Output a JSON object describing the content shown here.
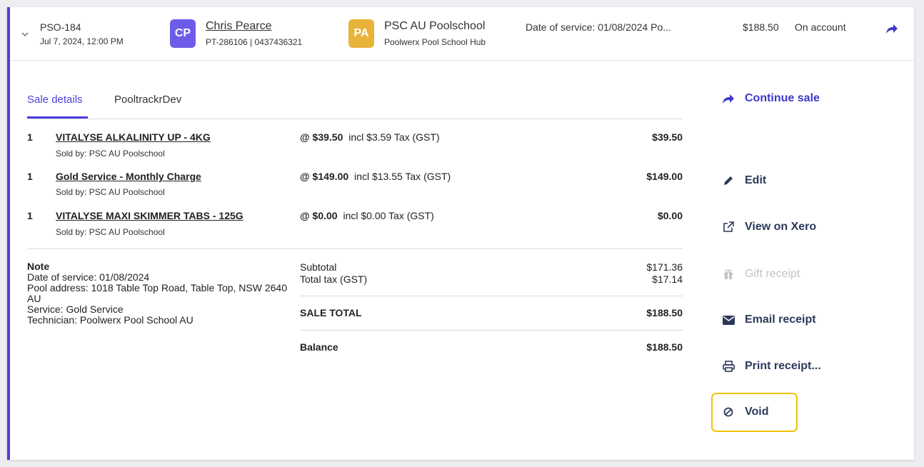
{
  "header": {
    "order_id": "PSO-184",
    "order_date": "Jul 7, 2024, 12:00 PM",
    "customer": {
      "initials": "CP",
      "name": "Chris Pearce",
      "details": "PT-286106 | 0437436321"
    },
    "store": {
      "initials": "PA",
      "name": "PSC AU Poolschool",
      "hub": "Poolwerx Pool School Hub"
    },
    "service_summary": "Date of service: 01/08/2024 Po...",
    "total": "$188.50",
    "payment_status": "On account"
  },
  "tabs": {
    "sale_details": "Sale details",
    "pooltrackr": "PooltrackrDev"
  },
  "items": [
    {
      "qty": "1",
      "name": "VITALYSE ALKALINITY UP - 4KG",
      "sold_by": "Sold by: PSC AU Poolschool",
      "unit_price": "@ $39.50",
      "tax": "incl $3.59 Tax (GST)",
      "amount": "$39.50"
    },
    {
      "qty": "1",
      "name": "Gold Service - Monthly Charge",
      "sold_by": "Sold by: PSC AU Poolschool",
      "unit_price": "@ $149.00",
      "tax": "incl $13.55 Tax (GST)",
      "amount": "$149.00"
    },
    {
      "qty": "1",
      "name": "VITALYSE MAXI SKIMMER TABS - 125G",
      "sold_by": "Sold by: PSC AU Poolschool",
      "unit_price": "@ $0.00",
      "tax": "incl $0.00 Tax (GST)",
      "amount": "$0.00"
    }
  ],
  "note": {
    "title": "Note",
    "lines": [
      "Date of service: 01/08/2024",
      "Pool address: 1018 Table Top Road, Table Top, NSW 2640",
      "AU",
      "Service: Gold Service",
      "Technician: Poolwerx Pool School AU"
    ]
  },
  "summary": {
    "subtotal_label": "Subtotal",
    "subtotal": "$171.36",
    "tax_label": "Total tax (GST)",
    "tax": "$17.14",
    "sale_total_label": "SALE TOTAL",
    "sale_total": "$188.50",
    "balance_label": "Balance",
    "balance": "$188.50"
  },
  "actions": {
    "continue_sale": "Continue sale",
    "edit": "Edit",
    "view_on_xero": "View on Xero",
    "gift_receipt": "Gift receipt",
    "email_receipt": "Email receipt",
    "print_receipt": "Print receipt...",
    "void": "Void"
  },
  "colors": {
    "accent": "#4b3fe0",
    "customer_avatar": "#6c5ce7",
    "store_avatar": "#e8b339",
    "highlight": "#f2c200"
  },
  "icons": [
    "chevron-down-icon",
    "share-arrow-icon",
    "pencil-icon",
    "external-link-icon",
    "gift-icon",
    "envelope-icon",
    "printer-icon",
    "ban-icon"
  ]
}
